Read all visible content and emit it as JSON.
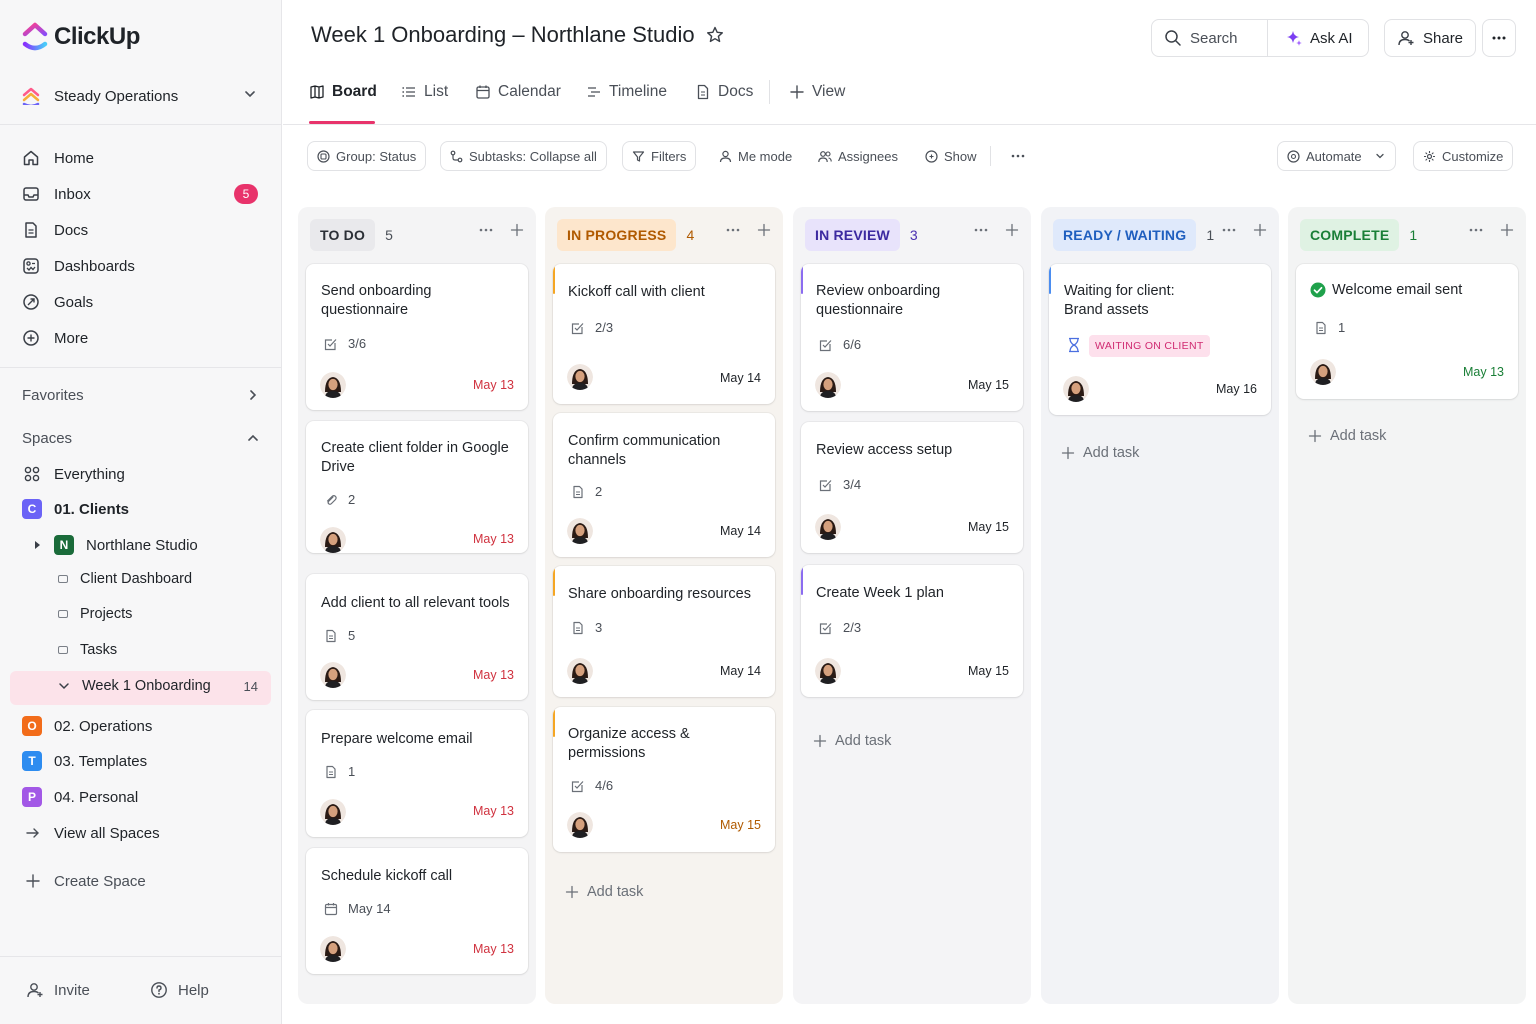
{
  "app": {
    "name": "ClickUp"
  },
  "workspace": {
    "name": "Steady Operations"
  },
  "nav": [
    {
      "label": "Home",
      "icon": "home-icon"
    },
    {
      "label": "Inbox",
      "icon": "inbox-icon",
      "badge": "5"
    },
    {
      "label": "Docs",
      "icon": "docs-icon"
    },
    {
      "label": "Dashboards",
      "icon": "dashboards-icon"
    },
    {
      "label": "Goals",
      "icon": "goals-icon"
    },
    {
      "label": "More",
      "icon": "more-icon"
    }
  ],
  "favorites_label": "Favorites",
  "spaces_label": "Spaces",
  "spaces": {
    "everything": "Everything",
    "clients": {
      "letter": "C",
      "label": "01. Clients",
      "color": "#6b63f6"
    },
    "northlane": {
      "letter": "N",
      "label": "Northlane Studio",
      "color": "#1a7f37"
    },
    "client_dashboard": "Client Dashboard",
    "projects": "Projects",
    "tasks": "Tasks",
    "week1": {
      "label": "Week 1 Onboarding",
      "count": "14"
    },
    "operations": {
      "letter": "O",
      "label": "02. Operations",
      "color": "#f26c1a"
    },
    "templates": {
      "letter": "T",
      "label": "03. Templates",
      "color": "#2d8cf0"
    },
    "personal": {
      "letter": "P",
      "label": "04. Personal",
      "color": "#a258e6"
    },
    "view_all": "View all Spaces",
    "create": "Create Space"
  },
  "bottom": {
    "invite": "Invite",
    "help": "Help"
  },
  "header": {
    "title": "Week 1 Onboarding – Northlane Studio",
    "search": "Search",
    "ask_ai": "Ask AI",
    "share": "Share"
  },
  "tabs": [
    "Board",
    "List",
    "Calendar",
    "Timeline",
    "Docs",
    "View"
  ],
  "filters": {
    "group": "Group: Status",
    "subtasks": "Subtasks: Collapse all",
    "filters": "Filters",
    "me_mode": "Me mode",
    "assignees": "Assignees",
    "show": "Show",
    "automate": "Automate",
    "customize": "Customize"
  },
  "add_task_label": "Add task",
  "columns": [
    {
      "name": "TO DO",
      "count": "5",
      "pill_bg": "#eeeef0",
      "pill_fg": "#2b2f36",
      "col_bg": "#f4f4f5",
      "accent": "#c9cace"
    },
    {
      "name": "IN PROGRESS",
      "count": "4",
      "pill_bg": "#fde9d3",
      "pill_fg": "#b05a00",
      "col_bg": "#fbf5ee",
      "accent": "#f5a623"
    },
    {
      "name": "IN REVIEW",
      "count": "3",
      "pill_bg": "#ebe6fb",
      "pill_fg": "#4a30b0",
      "col_bg": "#f4f3f8",
      "accent": "#8b6cf0"
    },
    {
      "name": "READY / WAITING",
      "count": "1",
      "pill_bg": "#e0ebfb",
      "pill_fg": "#1f5fbf",
      "col_bg": "#f2f4f8",
      "accent": "#4b8df0"
    },
    {
      "name": "COMPLETE",
      "count": "1",
      "pill_bg": "#e1f3e4",
      "pill_fg": "#1a7f37",
      "col_bg": "#f4f6f4",
      "accent": "#2da44e"
    }
  ],
  "cards": {
    "todo": [
      {
        "title": "Send onboarding questionnaire",
        "meta": "3/6",
        "due": "May 13"
      },
      {
        "title": "Create client folder in Google Drive",
        "meta": "2",
        "due": "May 13"
      },
      {
        "title": "Add client to all relevant tools",
        "meta": "5",
        "due": "May 13"
      },
      {
        "title": "Prepare welcome email",
        "meta": "1",
        "due": "May 13"
      },
      {
        "title": "Schedule kickoff call",
        "meta": "May 14",
        "due": "May 13"
      }
    ],
    "progress": [
      {
        "title": "Kickoff call with client",
        "meta": "2/3",
        "due": "May 14"
      },
      {
        "title": "Confirm communication channels",
        "meta": "2",
        "due": "May 14"
      },
      {
        "title": "Share onboarding resources",
        "meta": "3",
        "due": "May 14"
      },
      {
        "title": "Organize access & permissions",
        "meta": "4/6",
        "due": "May 15"
      }
    ],
    "review": [
      {
        "title": "Review onboarding questionnaire",
        "meta": "6/6",
        "due": "May 15"
      },
      {
        "title": "Review access setup",
        "meta": "3/4",
        "due": "May 15"
      },
      {
        "title": "Create Week 1 plan",
        "meta": "2/3",
        "due": "May 15"
      }
    ],
    "waiting": [
      {
        "title": "Waiting for client: Brand assets",
        "tag": "WAITING ON CLIENT",
        "due": "May 16"
      }
    ],
    "complete": [
      {
        "title": "Welcome email sent",
        "meta": "1",
        "due": "May 13"
      }
    ]
  }
}
